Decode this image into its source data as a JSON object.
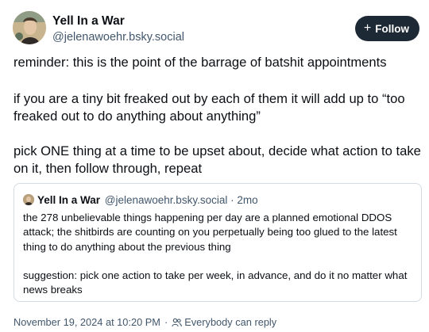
{
  "author": {
    "name": "Yell In a War",
    "handle": "@jelenawoehr.bsky.social"
  },
  "follow_button": {
    "icon": "plus-icon",
    "label": "Follow"
  },
  "post": {
    "paragraphs": [
      "reminder: this is the point of the barrage of batshit appointments",
      "if you are a tiny bit freaked out by each of them it will add up to “too freaked out to do anything about anything”",
      "pick ONE thing at a time to be upset about, decide what action to take on it, then follow through, repeat"
    ]
  },
  "quoted_post": {
    "author_name": "Yell In a War",
    "author_handle": "@jelenawoehr.bsky.social",
    "separator": "·",
    "time": "2mo",
    "paragraphs": [
      "the 278 unbelievable things happening per day are a planned emotional DDOS attack; the shitbirds are counting on you perpetually being too glued to the latest thing to do anything about the previous thing",
      "suggestion: pick one action to take per week, in advance, and do it no matter what news breaks"
    ]
  },
  "meta": {
    "timestamp": "November 19, 2024 at 10:20 PM",
    "separator": "·",
    "reply_setting": "Everybody can reply",
    "reply_icon": "people-icon"
  },
  "colors": {
    "primary_text": "#0b0f14",
    "secondary_text": "#42576c",
    "follow_button_bg": "#1e2936",
    "border": "#d4dbe2"
  }
}
